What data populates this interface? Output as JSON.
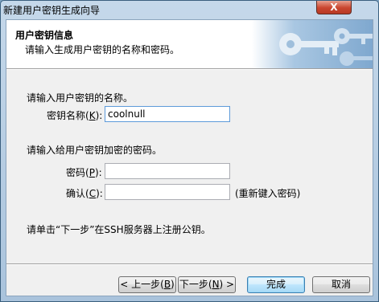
{
  "window": {
    "title": "新建用户密钥生成向导",
    "close_label": "X"
  },
  "header": {
    "title": "用户密钥信息",
    "subtitle": "请输入生成用户密钥的名称和密码。"
  },
  "name_section": {
    "prompt": "请输入用户密钥的名称。",
    "label": "密钥名称(",
    "accel": "K",
    "suffix": "):",
    "value": "coolnull"
  },
  "password_section": {
    "prompt": "请输入给用户密钥加密的密码。",
    "password_label": "密码(",
    "password_accel": "P",
    "password_suffix": "):",
    "password_value": "",
    "confirm_label": "确认(",
    "confirm_accel": "C",
    "confirm_suffix": "):",
    "confirm_value": "",
    "reenter_hint": "(重新键入密码)"
  },
  "footer_note": "请单击“下一步”在SSH服务器上注册公钥。",
  "buttons": {
    "back_pre": "< 上一步(",
    "back_accel": "B",
    "back_post": ")",
    "next_pre": "下一步(",
    "next_accel": "N",
    "next_post": ") >",
    "finish": "完成",
    "cancel": "取消"
  },
  "colors": {
    "accent": "#3c7fb1",
    "header_bg": "#ffffff",
    "dialog_bg": "#f0f0f0",
    "close_red": "#c9452f"
  }
}
